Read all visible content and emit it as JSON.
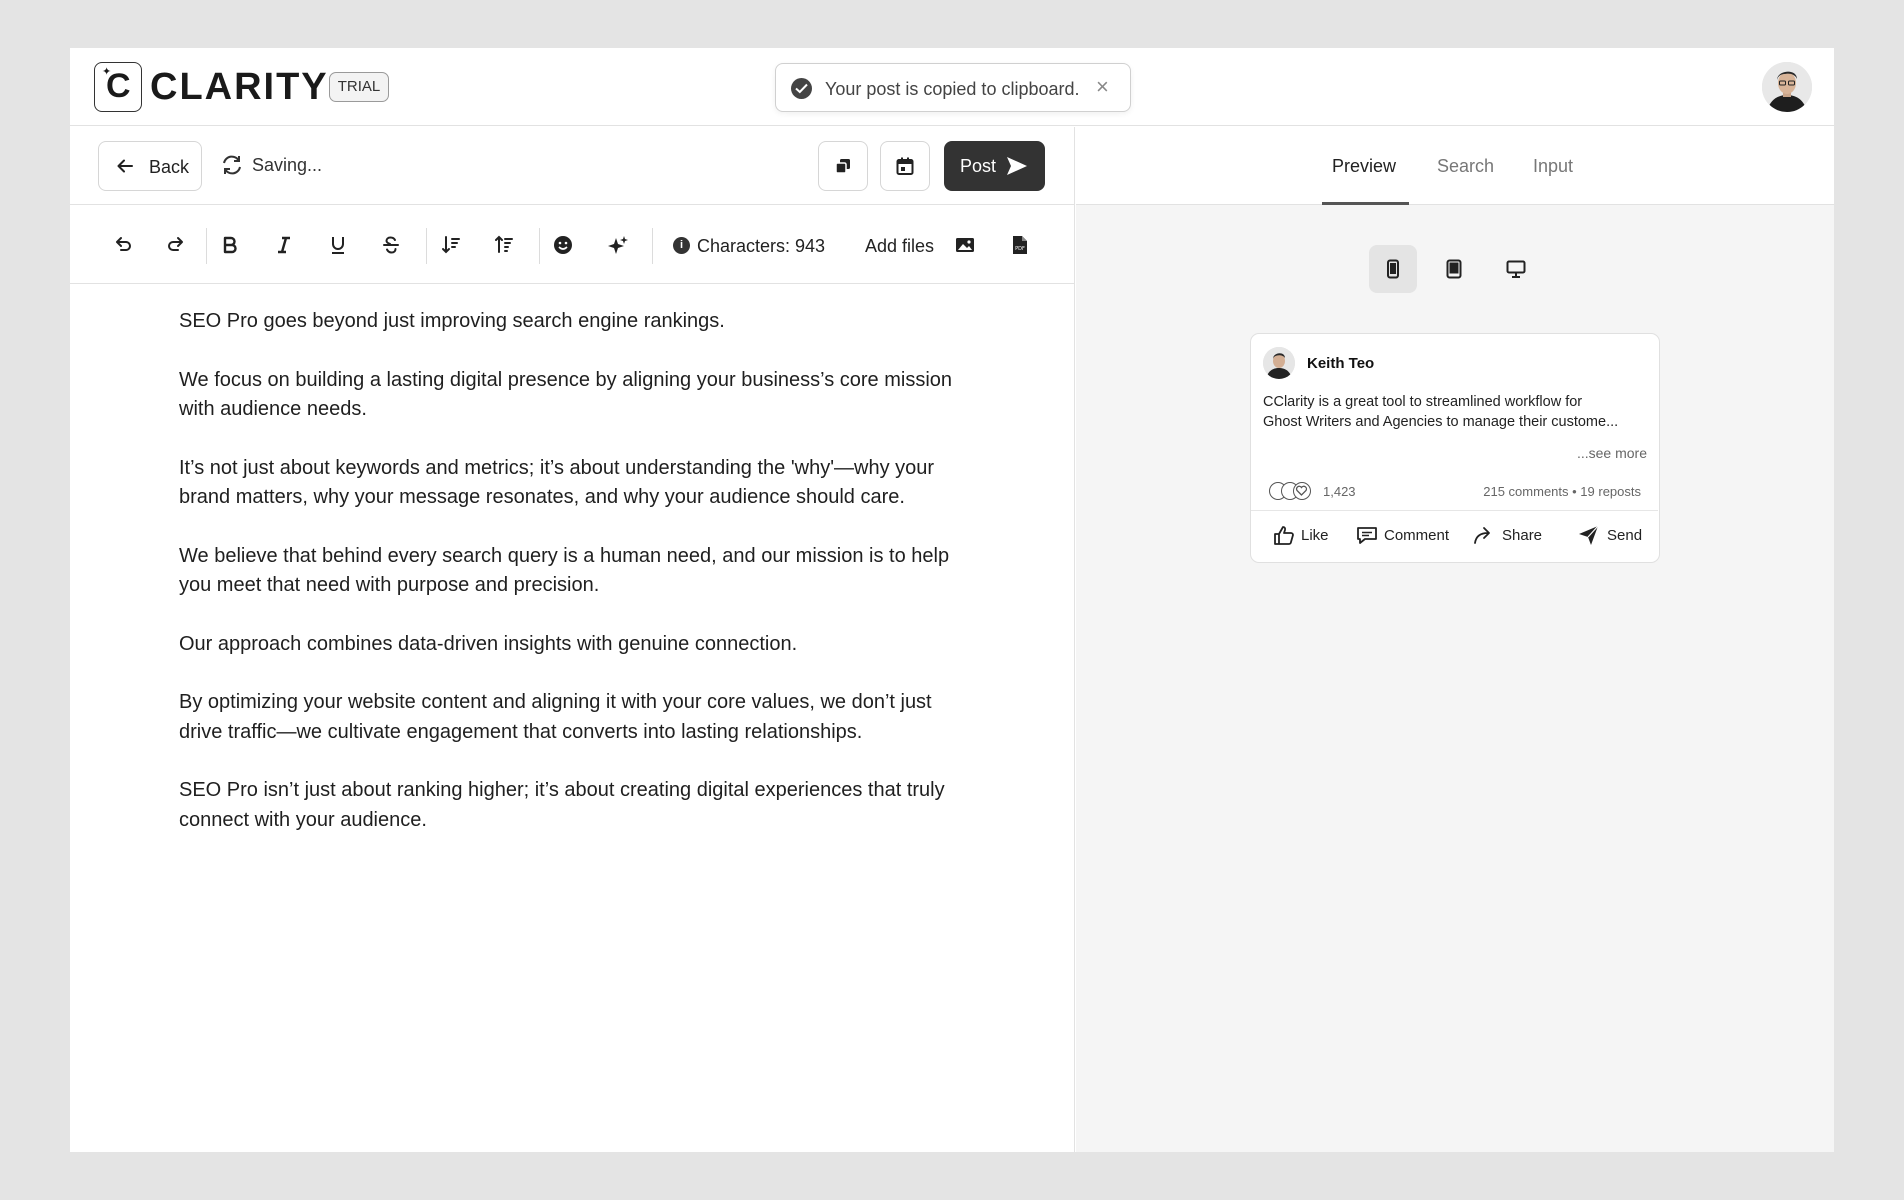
{
  "header": {
    "brand": "CLARITY",
    "badge": "TRIAL",
    "toast_message": "Your post is copied to clipboard.",
    "toast_close": "×"
  },
  "editor_bar": {
    "back_label": "Back",
    "saving_label": "Saving...",
    "post_label": "Post"
  },
  "toolbar": {
    "characters_label": "Characters: 943",
    "add_files_label": "Add files",
    "icons": [
      "undo-icon",
      "redo-icon",
      "bold-icon",
      "italic-icon",
      "underline-icon",
      "strikethrough-icon",
      "sort-descending-icon",
      "sort-ascending-icon",
      "emoji-icon",
      "sparkle-icon",
      "info-icon",
      "image-icon",
      "pdf-icon"
    ]
  },
  "editor": {
    "paragraphs": [
      "SEO Pro goes beyond just improving search engine rankings.",
      "We focus on building a lasting digital presence by aligning your business’s core mission with audience needs.",
      "It’s not just about keywords and metrics; it’s about understanding the 'why'—why your brand matters, why your message resonates, and why your audience should care.",
      "We believe that behind every search query is a human need, and our mission is to help you meet that need with purpose and precision.",
      "Our approach combines data-driven insights with genuine connection.",
      "By optimizing your website content and aligning it with your core values, we don’t just drive traffic—we cultivate engagement that converts into lasting relationships.",
      "SEO Pro isn’t just about ranking higher; it’s about creating digital experiences that truly connect with your audience."
    ]
  },
  "preview": {
    "tabs": [
      {
        "label": "Preview",
        "active": true
      },
      {
        "label": "Search",
        "active": false
      },
      {
        "label": "Input",
        "active": false
      }
    ],
    "devices": [
      "mobile-icon",
      "tablet-icon",
      "desktop-icon"
    ],
    "selected_device": "mobile",
    "post": {
      "author": "Keith Teo",
      "text_line1": "CClarity is a great tool to streamlined workflow for",
      "text_line2": "Ghost Writers and Agencies to manage their custome...",
      "see_more": "...see more",
      "reactions_count": "1,423",
      "stats": "215 comments • 19 reposts",
      "actions": {
        "like": "Like",
        "comment": "Comment",
        "share": "Share",
        "send": "Send"
      }
    }
  },
  "colors": {
    "dark_button": "#333333",
    "panel_bg": "#f5f5f5",
    "page_bg": "#e4e4e4"
  }
}
